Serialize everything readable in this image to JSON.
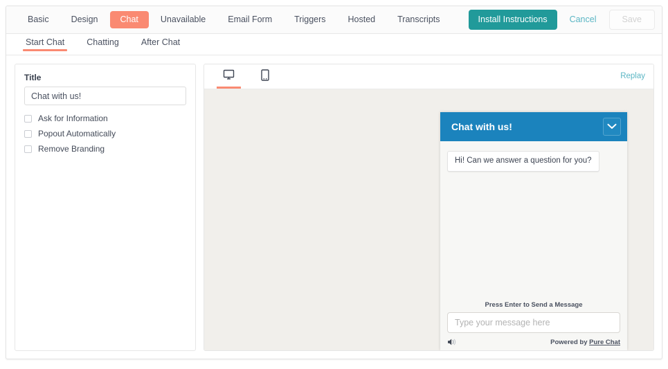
{
  "primary_tabs": [
    {
      "label": "Basic",
      "active": false
    },
    {
      "label": "Design",
      "active": false
    },
    {
      "label": "Chat",
      "active": true
    },
    {
      "label": "Unavailable",
      "active": false
    },
    {
      "label": "Email Form",
      "active": false
    },
    {
      "label": "Triggers",
      "active": false
    },
    {
      "label": "Hosted",
      "active": false
    },
    {
      "label": "Transcripts",
      "active": false
    }
  ],
  "actions": {
    "install_label": "Install Instructions",
    "cancel_label": "Cancel",
    "save_label": "Save",
    "save_disabled": true
  },
  "secondary_tabs": [
    {
      "label": "Start Chat",
      "active": true
    },
    {
      "label": "Chatting",
      "active": false
    },
    {
      "label": "After Chat",
      "active": false
    }
  ],
  "settings": {
    "title_label": "Title",
    "title_value": "Chat with us!",
    "title_placeholder": "Enter a title",
    "checkboxes": [
      {
        "label": "Ask for Information",
        "checked": false
      },
      {
        "label": "Popout Automatically",
        "checked": false
      },
      {
        "label": "Remove Branding",
        "checked": false
      }
    ]
  },
  "preview": {
    "device_tabs": [
      {
        "name": "desktop",
        "icon": "monitor-icon",
        "active": true
      },
      {
        "name": "mobile",
        "icon": "mobile-icon",
        "active": false
      }
    ],
    "replay_label": "Replay"
  },
  "widget": {
    "header_title": "Chat with us!",
    "minimize_icon": "chevron-down-icon",
    "greeting": "Hi! Can we answer a question for you?",
    "press_enter": "Press Enter to Send a Message",
    "input_value": "",
    "input_placeholder": "Type your message here",
    "sound_icon": "speaker-icon",
    "powered_by_prefix": "Powered by ",
    "powered_by_link": "Pure Chat"
  },
  "colors": {
    "accent_coral": "#fa8a72",
    "teal": "#219a9a",
    "link_blue": "#5bb6c4",
    "widget_blue": "#1b83bd",
    "stage_bg": "#f1efeb"
  }
}
